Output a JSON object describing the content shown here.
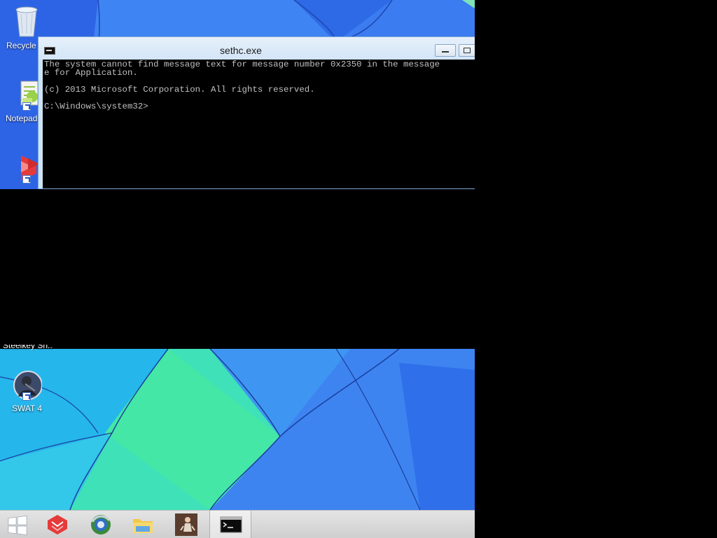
{
  "desktop": {
    "icons": [
      {
        "label": "Recycle"
      },
      {
        "label": "Notepad"
      },
      {
        "label": "Steelkey Sh..."
      },
      {
        "label": "SWAT 4"
      }
    ]
  },
  "console": {
    "title": "sethc.exe",
    "lines": [
      "The system cannot find message text for message number 0x2350 in the message",
      "e for Application.",
      "",
      "(c) 2013 Microsoft Corporation. All rights reserved.",
      "",
      "C:\\Windows\\system32>"
    ]
  },
  "taskbar": {
    "items": [
      {
        "icon": "windows-start-icon"
      },
      {
        "icon": "steelkey-icon"
      },
      {
        "icon": "browser-globe-icon"
      },
      {
        "icon": "file-explorer-icon"
      },
      {
        "icon": "app-figure-icon"
      },
      {
        "icon": "command-prompt-icon"
      }
    ]
  },
  "colors": {
    "console_text": "#c0c0c0",
    "console_bg": "#000000",
    "title_bar": "#d3e5f7"
  }
}
